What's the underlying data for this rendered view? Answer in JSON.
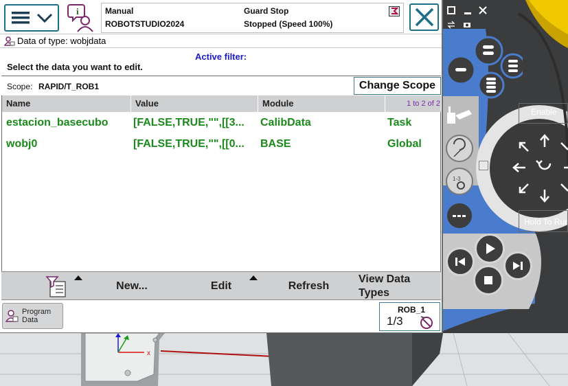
{
  "topbar": {
    "menu_icon": "hamburger-menu-icon",
    "status_icon": "operator-message-icon",
    "mode": "Manual",
    "controller": "ROBOTSTUDIO2024",
    "state": "Guard Stop",
    "run_state": "Stopped (Speed 100%)",
    "close_icon": "close-icon"
  },
  "view": {
    "title": "Data of type: wobjdata",
    "active_filter_label": "Active filter:",
    "instruction": "Select the data you want to edit.",
    "scope_label": "Scope:",
    "scope_value": "RAPID/T_ROB1",
    "change_scope_label": "Change Scope"
  },
  "table": {
    "columns": [
      "Name",
      "Value",
      "Module"
    ],
    "paging": "1 to 2 of 2",
    "rows": [
      {
        "name": "estacion_basecubo",
        "value": "[FALSE,TRUE,\"\",[[3...",
        "module": "CalibData",
        "scope": "Task"
      },
      {
        "name": "wobj0",
        "value": "[FALSE,TRUE,\"\",[[0...",
        "module": "BASE",
        "scope": "Global"
      }
    ]
  },
  "commands": {
    "filter_icon": "filter-icon",
    "new_label": "New...",
    "edit_label": "Edit",
    "refresh_label": "Refresh",
    "view_types_line1": "View Data",
    "view_types_line2": "Types"
  },
  "taskbar": {
    "program_data_line1": "Program",
    "program_data_line2": "Data",
    "rob_label": "ROB_1",
    "rob_fraction": "1/3"
  },
  "hardware": {
    "enable_label": "Enable",
    "hold_to_run_label": "Hold To Run"
  },
  "colors": {
    "accent": "#1c6f84",
    "data_text": "#1a8a1a",
    "header_bg": "#cfd0d2",
    "filter_blue": "#1a1acc",
    "hw_blue": "#4a7ccd"
  }
}
